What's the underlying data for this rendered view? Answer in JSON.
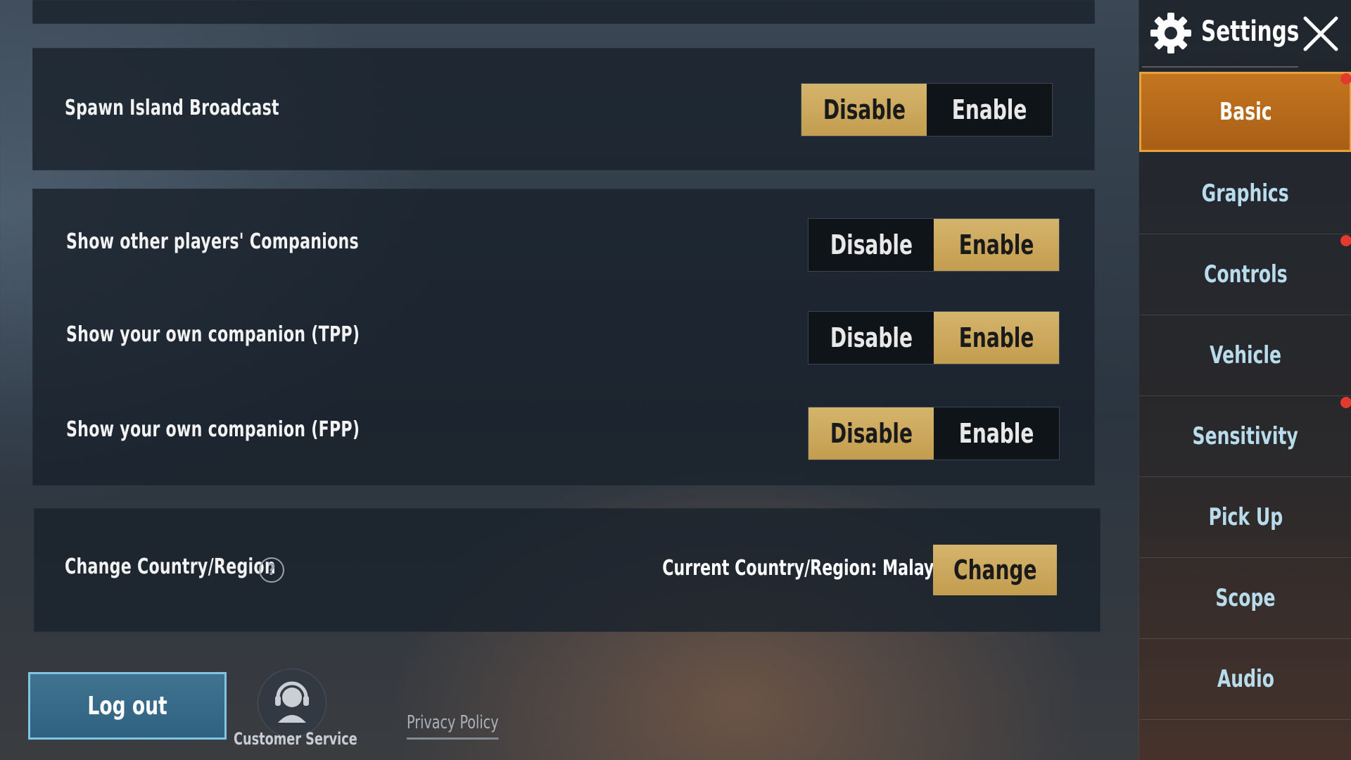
{
  "sidebar": {
    "title": "Settings",
    "items": [
      {
        "label": "Basic",
        "active": true
      },
      {
        "label": "Graphics"
      },
      {
        "label": "Controls"
      },
      {
        "label": "Vehicle"
      },
      {
        "label": "Sensitivity"
      },
      {
        "label": "Pick Up"
      },
      {
        "label": "Scope"
      },
      {
        "label": "Audio"
      }
    ]
  },
  "settings": {
    "spawn_island_broadcast": {
      "label": "Spawn Island Broadcast",
      "disable": "Disable",
      "enable": "Enable",
      "selected": "Disable"
    },
    "other_companions": {
      "label": "Show other players' Companions",
      "disable": "Disable",
      "enable": "Enable",
      "selected": "Enable"
    },
    "own_companion_tpp": {
      "label": "Show your own companion (TPP)",
      "disable": "Disable",
      "enable": "Enable",
      "selected": "Enable"
    },
    "own_companion_fpp": {
      "label": "Show your own companion (FPP)",
      "disable": "Disable",
      "enable": "Enable",
      "selected": "Disable"
    },
    "country_region": {
      "label": "Change Country/Region",
      "help": "?",
      "current": "Current Country/Region: Malaysia",
      "change_button": "Change"
    }
  },
  "footer": {
    "logout": "Log out",
    "customer_service": "Customer Service",
    "privacy_policy": "Privacy Policy"
  },
  "colors": {
    "accent_gold": "#c9a75c",
    "active_tab": "#b86a1a",
    "notification_dot": "#e23b2e",
    "logout_blue": "#3a6d8c"
  }
}
